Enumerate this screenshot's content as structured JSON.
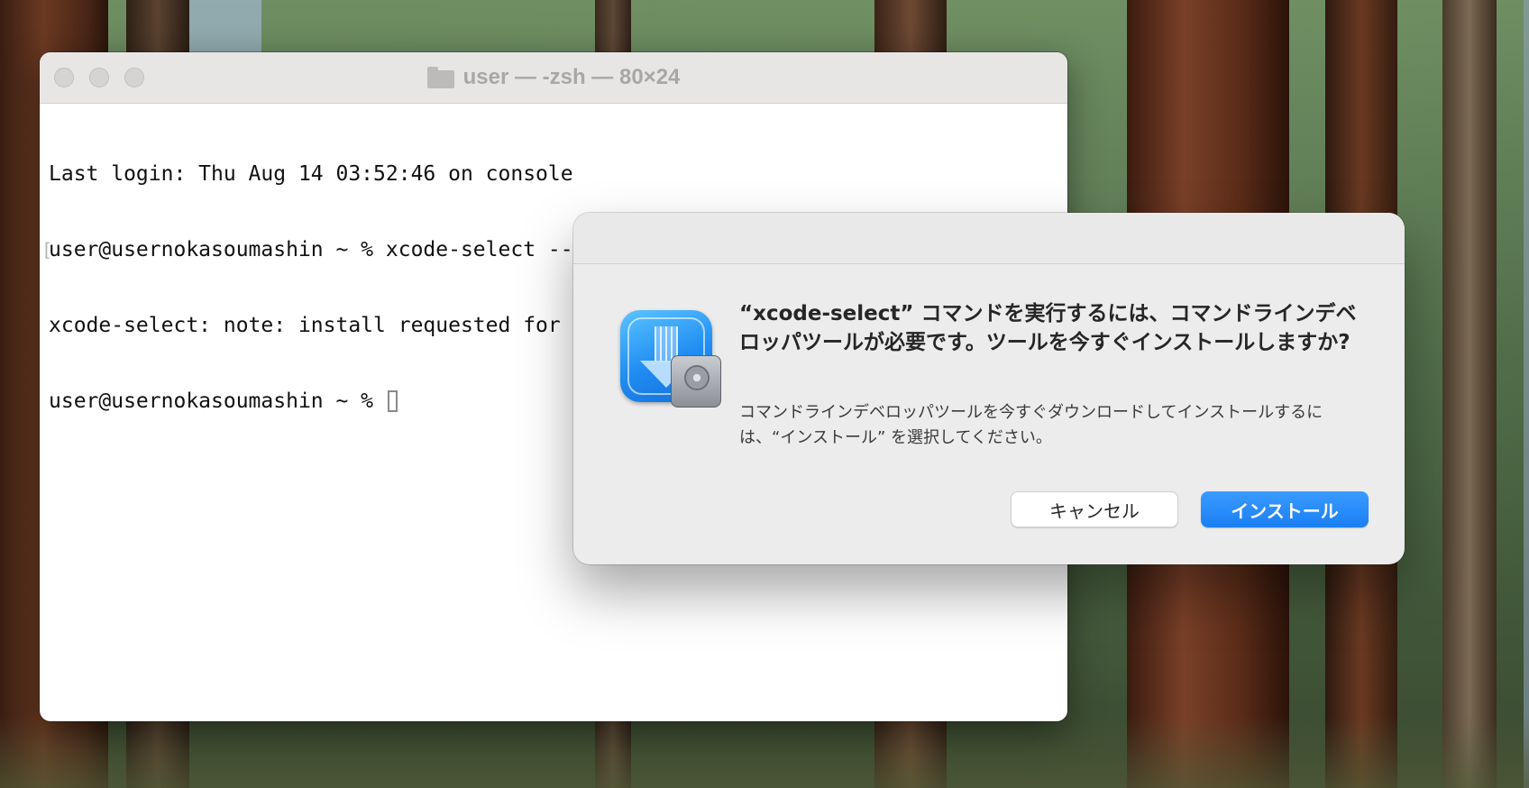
{
  "terminal": {
    "title": "user — -zsh — 80×24",
    "lines": [
      "Last login: Thu Aug 14 03:52:46 on console",
      "user@usernokasoumashin ~ % xcode-select --install",
      "xcode-select: note: install requested for command line developer tools",
      "user@usernokasoumashin ~ % "
    ]
  },
  "dialog": {
    "title": "“xcode-select” コマンドを実行するには、コマンドラインデベロッパツールが必要です。ツールを今すぐインストールしますか?",
    "message": "コマンドラインデベロッパツールを今すぐダウンロードしてインストールするには、“インストール” を選択してください。",
    "cancel_label": "キャンセル",
    "install_label": "インストール",
    "icon": "software-update-disk-icon"
  },
  "colors": {
    "accent": "#1a7ff5",
    "dialog_bg": "#ececec",
    "terminal_bg": "#ffffff"
  }
}
